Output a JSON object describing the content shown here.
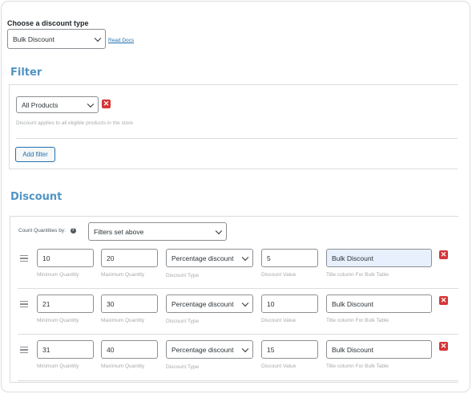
{
  "discount_type": {
    "label": "Choose a discount type",
    "selected": "Bulk Discount",
    "read_docs": "Read Docs"
  },
  "filter": {
    "heading": "Filter",
    "selected": "All Products",
    "remove_icon": "x-icon",
    "helper": "Discount applies to all eligible products in the store",
    "add_filter": "Add filter"
  },
  "discount": {
    "heading": "Discount",
    "count_label": "Count Quantities by:",
    "help_icon": "question-circle-icon",
    "count_selected": "Filters set above",
    "labels": {
      "min": "Minimum Quantity",
      "max": "Maximum Quantity",
      "type": "Discount Type",
      "value": "Discount Value",
      "title": "Title column For Bulk Table"
    },
    "rows": [
      {
        "min": "10",
        "max": "20",
        "type": "Percentage discount",
        "value": "5",
        "title": "Bulk Discount"
      },
      {
        "min": "21",
        "max": "30",
        "type": "Percentage discount",
        "value": "10",
        "title": "Bulk Discount"
      },
      {
        "min": "31",
        "max": "40",
        "type": "Percentage discount",
        "value": "15",
        "title": "Bulk Discount"
      }
    ]
  },
  "colors": {
    "accent": "#2271b1",
    "heading": "#4f94c6",
    "danger": "#d63638"
  }
}
